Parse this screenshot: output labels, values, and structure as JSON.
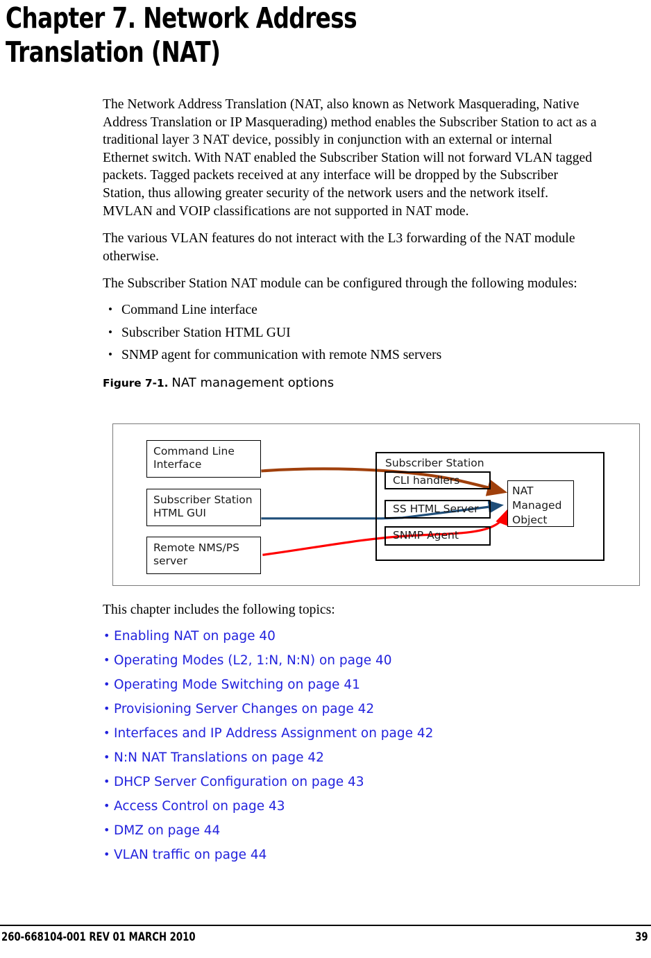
{
  "document": {
    "chapter_title": "Chapter 7. Network Address\nTranslation (NAT)",
    "paragraphs": [
      "The Network Address Translation (NAT, also known as Network Masquerading, Native Address Translation or IP Masquerading) method enables the Subscriber Station to act as a traditional layer 3 NAT device, possibly in conjunction with an external or internal Ethernet switch. With NAT enabled the Subscriber Station will not forward VLAN tagged packets. Tagged packets received at any interface will be dropped by the Subscriber Station, thus allowing greater security of the network users and the network itself. MVLAN and VOIP classifications are not supported in NAT mode.",
      "The various VLAN features do not interact with the L3 forwarding of the NAT module otherwise.",
      "The Subscriber Station NAT module can be configured through the following modules:"
    ],
    "module_bullets": [
      "Command Line interface",
      "Subscriber Station HTML GUI",
      "SNMP agent for communication with remote NMS servers"
    ],
    "figure": {
      "label": "Figure 7-1.",
      "title": "NAT management options",
      "boxes": {
        "command_line_interface": "Command Line\nInterface",
        "subscriber_station_html_gui": "Subscriber Station\nHTML GUI",
        "remote_nms_ps_server": "Remote NMS/PS\nserver",
        "subscriber_station": "Subscriber Station",
        "cli_handlers": "CLI handlers",
        "ss_html_server": "SS HTML Server",
        "snmp_agent": "SNMP Agent",
        "nat_managed_object": "NAT\nManaged\nObject"
      },
      "arrow_colors": {
        "cli_arrow": "#a0400c",
        "html_gui_arrow": "#1f4e79",
        "snmp_arrow": "#ff0000"
      }
    },
    "topics_intro": "This chapter includes the following topics:",
    "topics": [
      "Enabling NAT on page 40",
      "Operating Modes (L2, 1:N, N:N) on page 40",
      "Operating Mode Switching on page 41",
      "Provisioning Server Changes on page 42",
      "Interfaces and IP Address Assignment on page 42",
      "N:N NAT Translations on page 42",
      "DHCP Server Configuration on page 43",
      "Access Control on page 43",
      "DMZ on page 44",
      "VLAN traffic on page 44"
    ],
    "footer": {
      "document_id": "260-668104-001 REV 01 MARCH 2010",
      "page_number": "39"
    },
    "colors": {
      "link": "#2222dd",
      "text": "#000000"
    }
  }
}
